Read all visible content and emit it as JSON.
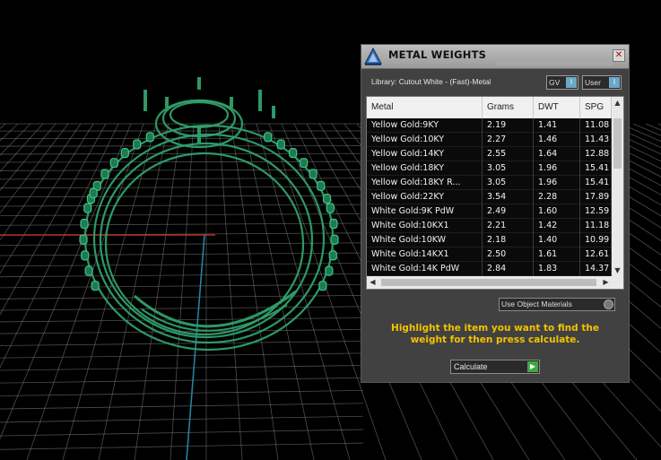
{
  "panel": {
    "title": "METAL WEIGHTS",
    "close_icon": "close-icon",
    "library_label": "Library: Cutout White - (Fast)-Metal",
    "gv_select": "GV",
    "user_select": "User",
    "use_object_materials": "Use Object Materials",
    "instruction": "Highlight the item you want to find the weight for then press calculate.",
    "calculate_label": "Calculate"
  },
  "table": {
    "headers": [
      "Metal",
      "Grams",
      "DWT",
      "SPG"
    ],
    "rows": [
      [
        "Yellow Gold:9KY",
        "2.19",
        "1.41",
        "11.08"
      ],
      [
        "Yellow Gold:10KY",
        "2.27",
        "1.46",
        "11.43"
      ],
      [
        "Yellow Gold:14KY",
        "2.55",
        "1.64",
        "12.88"
      ],
      [
        "Yellow Gold:18KY",
        "3.05",
        "1.96",
        "15.41"
      ],
      [
        "Yellow Gold:18KY R...",
        "3.05",
        "1.96",
        "15.41"
      ],
      [
        "Yellow Gold:22KY",
        "3.54",
        "2.28",
        "17.89"
      ],
      [
        "White Gold:9K PdW",
        "2.49",
        "1.60",
        "12.59"
      ],
      [
        "White Gold:10KX1",
        "2.21",
        "1.42",
        "11.18"
      ],
      [
        "White Gold:10KW",
        "2.18",
        "1.40",
        "10.99"
      ],
      [
        "White Gold:14KX1",
        "2.50",
        "1.61",
        "12.61"
      ],
      [
        "White Gold:14K PdW",
        "2.84",
        "1.83",
        "14.37"
      ]
    ]
  },
  "colors": {
    "ring_green": "#2fa06c",
    "grid_line": "#8a8a8a",
    "x_axis": "#c0392b",
    "y_axis": "#2a8fb0",
    "instruction_text": "#f2c200"
  }
}
